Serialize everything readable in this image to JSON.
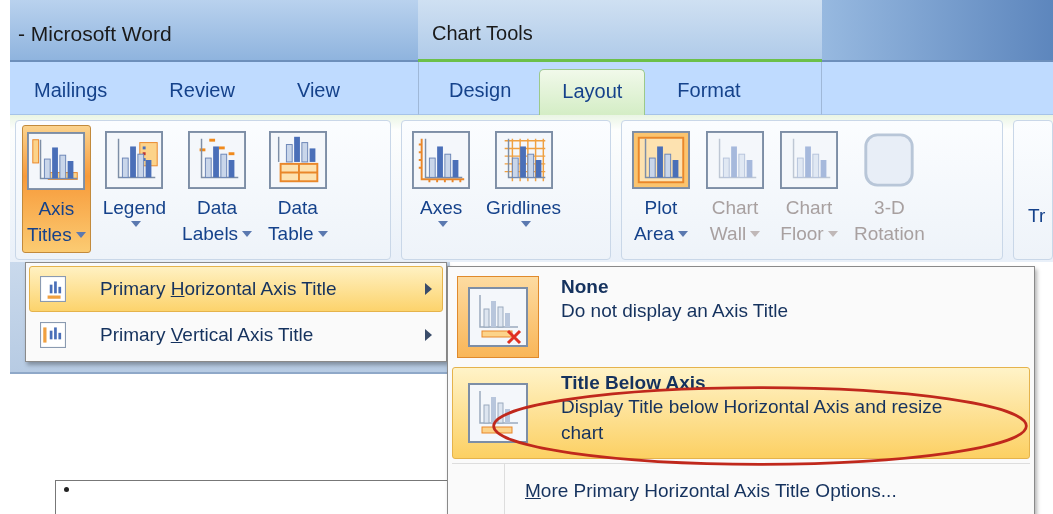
{
  "window": {
    "title": "- Microsoft Word"
  },
  "tabs": [
    {
      "label": "Mailings",
      "selected": false
    },
    {
      "label": "Review",
      "selected": false
    },
    {
      "label": "View",
      "selected": false
    }
  ],
  "context_tabs": {
    "title": "Chart Tools",
    "tabs": [
      {
        "label": "Design",
        "selected": false
      },
      {
        "label": "Layout",
        "selected": true
      },
      {
        "label": "Format",
        "selected": false
      }
    ]
  },
  "ribbon": {
    "groups": [
      {
        "buttons": [
          {
            "lines": [
              "Axis",
              "Titles"
            ],
            "kind": "axis-titles",
            "dropdown": true,
            "selected": true,
            "disabled": false
          },
          {
            "lines": [
              "Legend"
            ],
            "kind": "legend",
            "dropdown": true,
            "selected": false,
            "disabled": false
          },
          {
            "lines": [
              "Data",
              "Labels"
            ],
            "kind": "data-labels",
            "dropdown": true,
            "selected": false,
            "disabled": false
          },
          {
            "lines": [
              "Data",
              "Table"
            ],
            "kind": "data-table",
            "dropdown": true,
            "selected": false,
            "disabled": false
          }
        ]
      },
      {
        "buttons": [
          {
            "lines": [
              "Axes"
            ],
            "kind": "axes",
            "dropdown": true,
            "selected": false,
            "disabled": false
          },
          {
            "lines": [
              "Gridlines"
            ],
            "kind": "gridlines",
            "dropdown": true,
            "selected": false,
            "disabled": false
          }
        ]
      },
      {
        "buttons": [
          {
            "lines": [
              "Plot",
              "Area"
            ],
            "kind": "plot-area",
            "dropdown": true,
            "selected": false,
            "disabled": false
          },
          {
            "lines": [
              "Chart",
              "Wall"
            ],
            "kind": "chart-wall",
            "dropdown": true,
            "selected": false,
            "disabled": true
          },
          {
            "lines": [
              "Chart",
              "Floor"
            ],
            "kind": "chart-floor",
            "dropdown": true,
            "selected": false,
            "disabled": true
          },
          {
            "lines": [
              "3-D",
              "Rotation"
            ],
            "kind": "rotation",
            "dropdown": false,
            "selected": false,
            "disabled": true
          }
        ]
      },
      {
        "buttons": [
          {
            "lines": [
              "Tr"
            ],
            "kind": "text",
            "dropdown": false,
            "selected": false,
            "disabled": false
          }
        ]
      }
    ]
  },
  "menu": {
    "items": [
      {
        "pre": "Primary ",
        "key": "H",
        "post": "orizontal Axis Title",
        "kind": "horizontal",
        "hovered": true
      },
      {
        "pre": "Primary ",
        "key": "V",
        "post": "ertical Axis Title",
        "kind": "vertical",
        "hovered": false
      }
    ]
  },
  "submenu": {
    "items": [
      {
        "title": "None",
        "description": "Do not display an Axis Title",
        "kind": "none",
        "selected": true,
        "hovered": false,
        "annotated": false
      },
      {
        "title": "Title Below Axis",
        "description": "Display Title below Horizontal Axis and resize chart",
        "kind": "below",
        "selected": false,
        "hovered": true,
        "annotated": true
      }
    ],
    "more": {
      "key": "M",
      "post": "ore Primary Horizontal Axis Title Options..."
    }
  }
}
